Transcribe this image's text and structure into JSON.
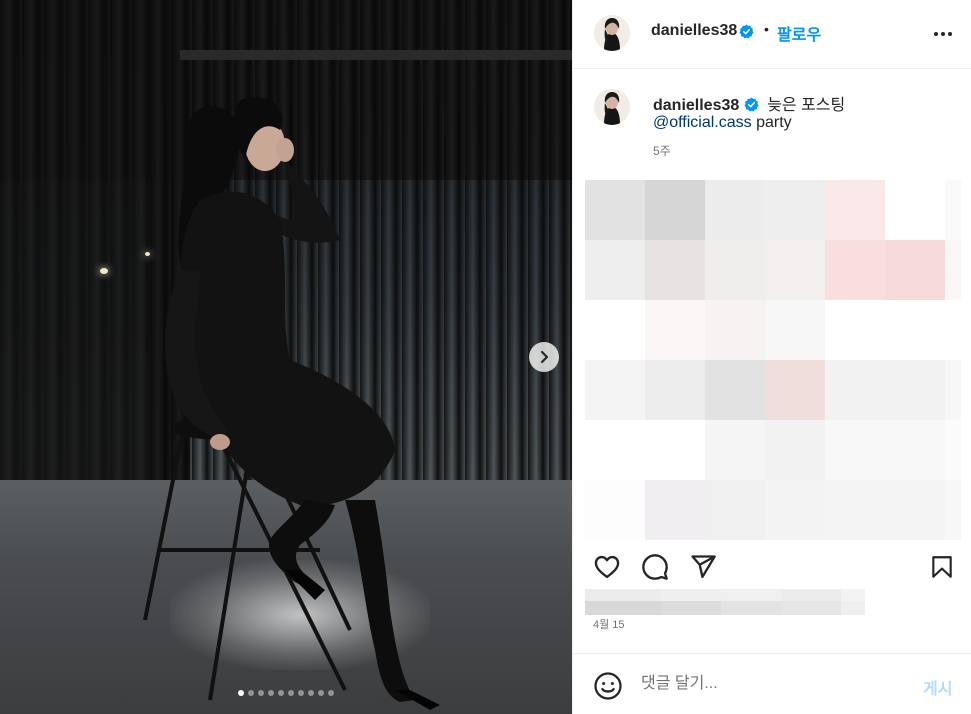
{
  "post": {
    "username": "danielles38",
    "follow_label": "팔로우",
    "separator": "•",
    "caption": {
      "username": "danielles38",
      "text": "늦은 포스팅",
      "mention": "@official.cass",
      "mention_suffix": " party",
      "time_ago": "5주"
    },
    "date": "4월 15",
    "comment": {
      "placeholder": "댓글 달기...",
      "post_label": "게시"
    }
  },
  "carousel": {
    "total": 10,
    "current": 1
  },
  "icons": {
    "verified": "verified-badge-icon",
    "more": "more-options-icon",
    "like": "heart-icon",
    "comment": "comment-bubble-icon",
    "share": "paper-plane-icon",
    "save": "bookmark-icon",
    "emoji": "emoji-smile-icon",
    "next": "chevron-right-icon"
  },
  "colors": {
    "accent": "#0095f6",
    "verified": "#0095f6",
    "post_disabled": "#b3dbff",
    "mention": "#00376b",
    "muted": "#737373"
  }
}
